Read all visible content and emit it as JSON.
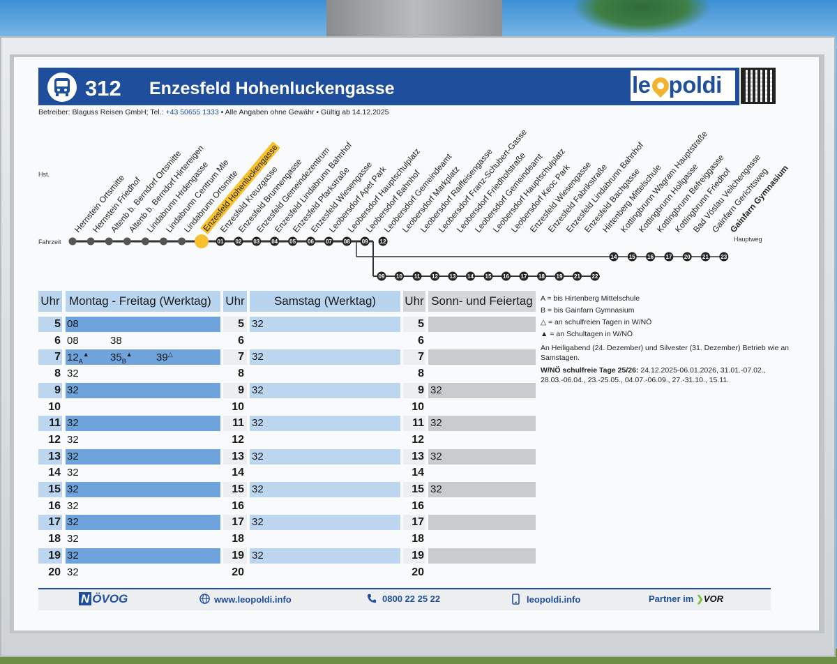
{
  "header": {
    "line_number": "312",
    "route_name": "Enzesfeld Hohenluckengasse",
    "brand": "leopoldi"
  },
  "operator_info": {
    "text_before": "Betreiber: Blaguss Reisen GmbH; Tel.: ",
    "phone": "+43 50655 1333",
    "text_after": " • Alle Angaben ohne Gewähr • Gültig ab 14.12.2025"
  },
  "labels": {
    "hst": "Hst.",
    "fahrzeit": "Fahrzeit",
    "hauptweg": "Hauptweg"
  },
  "stops": [
    "Hernstein Ortsmitte",
    "Hernstein Friedhof",
    "Altenb b. Berndorf Ortsmitte",
    "Altenb b. Berndorf Hirtereigen",
    "Lindabrunn Hrdengasse",
    "Lindabrunn Centrum Mle",
    "Lindabrunn Ortsmitte",
    "Enzesfeld Hohenluckengasse",
    "Enzesfeld Kreuzgasse",
    "Enzesfeld Brunnengasse",
    "Enzesfeld Gemeindezentrum",
    "Enzesfeld Lindabrunn Bahnhof",
    "Enzesfeld Pfarkstraße",
    "Enzesfeld Wiesengasse",
    "Leobersdorf Apet Park",
    "Leobersdorf Hauptschulplatz",
    "Leobersdorf Bahnhof",
    "Leobersdorf Gemeindeamt",
    "Leobersdorf Markplatz",
    "Leobersdorf Raiffeisengasse",
    "Leobersdorf Franz-Schubert-Gasse",
    "Leobersdorf Friedhofstraße",
    "Leobersdorf Gemeindeamt",
    "Leobersdorf Hauptschulplatz",
    "Leobersdorf Keoc Park",
    "Enzesfeld Wiesengasse",
    "Enzesfeld Fabrikstraße",
    "Enzesfeld Lindabrunn Bahnhof",
    "Enzesfeld Bachgasse",
    "Hirtenberg Mittelschule",
    "Kottingbrunn Wagram Hauptstraße",
    "Kottingbrunn Hollgasse",
    "Kottingbrunn Befreiggasse",
    "Kottingbrunn Friedhof",
    "Bad Vöslau Veilchengasse",
    "Gainfarn Gerichtsweg",
    "Gainfarn Gymnasium"
  ],
  "stop_offsets_main_start": [
    "01",
    "02",
    "03",
    "04",
    "05",
    "06",
    "07",
    "08",
    "09",
    "12"
  ],
  "stop_offsets_branch": [
    "09",
    "10",
    "11",
    "12",
    "13",
    "14",
    "15",
    "16",
    "17",
    "18",
    "19",
    "21",
    "22"
  ],
  "stop_offsets_main_end": [
    "14",
    "15",
    "16",
    "17",
    "20",
    "21",
    "23"
  ],
  "timetable": {
    "columns": {
      "hour": "Uhr",
      "weekday": "Montag - Freitag (Werktag)",
      "saturday": "Samstag (Werktag)",
      "sunday": "Sonn- und Feiertag"
    },
    "rows": [
      {
        "hour": "5",
        "weekday": [
          {
            "m": "08"
          }
        ],
        "saturday": [
          "32"
        ],
        "sunday": []
      },
      {
        "hour": "6",
        "weekday": [
          {
            "m": "08"
          },
          {
            "m": "38"
          }
        ],
        "saturday": [],
        "sunday": []
      },
      {
        "hour": "7",
        "weekday": [
          {
            "m": "12",
            "sup": "▲",
            "sub": "A"
          },
          {
            "m": "35",
            "sup": "▲",
            "sub": "B"
          },
          {
            "m": "39",
            "sup": "△",
            "sub": ""
          }
        ],
        "saturday": [
          "32"
        ],
        "sunday": []
      },
      {
        "hour": "8",
        "weekday": [
          {
            "m": "32"
          }
        ],
        "saturday": [],
        "sunday": []
      },
      {
        "hour": "9",
        "weekday": [
          {
            "m": "32"
          }
        ],
        "saturday": [
          "32"
        ],
        "sunday": [
          "32"
        ]
      },
      {
        "hour": "10",
        "weekday": [],
        "saturday": [],
        "sunday": []
      },
      {
        "hour": "11",
        "weekday": [
          {
            "m": "32"
          }
        ],
        "saturday": [
          "32"
        ],
        "sunday": [
          "32"
        ]
      },
      {
        "hour": "12",
        "weekday": [
          {
            "m": "32"
          }
        ],
        "saturday": [],
        "sunday": []
      },
      {
        "hour": "13",
        "weekday": [
          {
            "m": "32"
          }
        ],
        "saturday": [
          "32"
        ],
        "sunday": [
          "32"
        ]
      },
      {
        "hour": "14",
        "weekday": [
          {
            "m": "32"
          }
        ],
        "saturday": [],
        "sunday": []
      },
      {
        "hour": "15",
        "weekday": [
          {
            "m": "32"
          }
        ],
        "saturday": [
          "32"
        ],
        "sunday": [
          "32"
        ]
      },
      {
        "hour": "16",
        "weekday": [
          {
            "m": "32"
          }
        ],
        "saturday": [],
        "sunday": []
      },
      {
        "hour": "17",
        "weekday": [
          {
            "m": "32"
          }
        ],
        "saturday": [
          "32"
        ],
        "sunday": []
      },
      {
        "hour": "18",
        "weekday": [
          {
            "m": "32"
          }
        ],
        "saturday": [],
        "sunday": []
      },
      {
        "hour": "19",
        "weekday": [
          {
            "m": "32"
          }
        ],
        "saturday": [
          "32"
        ],
        "sunday": []
      },
      {
        "hour": "20",
        "weekday": [
          {
            "m": "32"
          }
        ],
        "saturday": [],
        "sunday": []
      }
    ]
  },
  "notes": {
    "a": "A = bis Hirtenberg Mittelschule",
    "b": "B = bis Gainfarn Gymnasium",
    "open_triangle": "△ = an schulfreien Tagen in W/NÖ",
    "filled_triangle": "▲ = an Schultagen in W/NÖ",
    "holiday": "An Heiligabend (24. Dezember) und Silvester (31. Dezember) Betrieb wie an Samstagen.",
    "school_free_label": "W/NÖ schulfreie Tage 25/26:",
    "school_free_dates": " 24.12.2025-06.01.2026, 31.01.-07.02., 28.03.-06.04., 23.-25.05., 04.07.-06.09., 27.-31.10., 15.11."
  },
  "footer": {
    "noevog_n": "N",
    "noevog_rest": "ÖVOG",
    "website": "www.leopoldi.info",
    "phone": "0800 22 25 22",
    "app": "leopoldi.info",
    "partner": "Partner im",
    "vor": "VOR"
  },
  "icons": [
    "bus-icon",
    "globe-icon",
    "phone-icon",
    "smartphone-icon",
    "location-pin-icon"
  ],
  "colors": {
    "brand_blue": "#1f4f9c",
    "row_blue": "#6fa3dc",
    "row_lightblue": "#bcd6f0",
    "row_gray": "#c9cbcd",
    "highlight_yellow": "#f6c12c"
  }
}
